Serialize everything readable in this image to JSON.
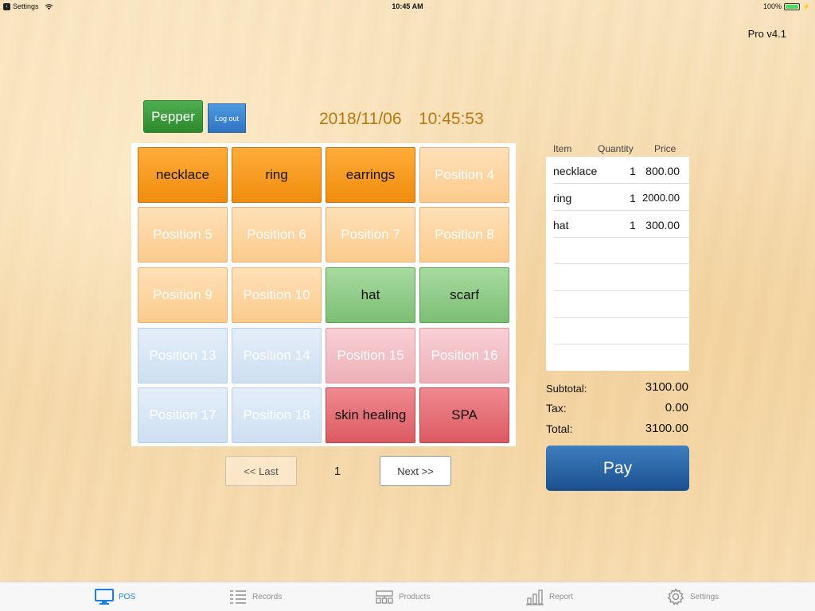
{
  "status_bar": {
    "back_label": "Settings",
    "time": "10:45 AM",
    "battery": "100%"
  },
  "app_version": "Pro v4.1",
  "header": {
    "user_name": "Pepper",
    "logout_label": "Log out",
    "date": "2018/11/06",
    "time": "10:45:53"
  },
  "tiles": [
    {
      "label": "necklace",
      "style": "orange-on"
    },
    {
      "label": "ring",
      "style": "orange-on"
    },
    {
      "label": "earrings",
      "style": "orange-on"
    },
    {
      "label": "Position 4",
      "style": "orange-off"
    },
    {
      "label": "Position 5",
      "style": "orange-off"
    },
    {
      "label": "Position 6",
      "style": "orange-off"
    },
    {
      "label": "Position 7",
      "style": "orange-off"
    },
    {
      "label": "Position 8",
      "style": "orange-off"
    },
    {
      "label": "Position 9",
      "style": "orange-off"
    },
    {
      "label": "Position 10",
      "style": "orange-off"
    },
    {
      "label": "hat",
      "style": "green-on"
    },
    {
      "label": "scarf",
      "style": "green-on"
    },
    {
      "label": "Position 13",
      "style": "blue-off"
    },
    {
      "label": "Position 14",
      "style": "blue-off"
    },
    {
      "label": "Position 15",
      "style": "pink-off"
    },
    {
      "label": "Position 16",
      "style": "pink-off"
    },
    {
      "label": "Position 17",
      "style": "blue-off"
    },
    {
      "label": "Position 18",
      "style": "blue-off"
    },
    {
      "label": "skin healing",
      "style": "red-on"
    },
    {
      "label": "SPA",
      "style": "red-on"
    }
  ],
  "pagination": {
    "prev_label": "<< Last",
    "page": "1",
    "next_label": "Next  >>"
  },
  "order": {
    "headers": {
      "item": "Item",
      "quantity": "Quantity",
      "price": "Price"
    },
    "rows": [
      {
        "name": "necklace",
        "qty": "1",
        "price": "800.00"
      },
      {
        "name": "ring",
        "qty": "1",
        "price": "2000.00"
      },
      {
        "name": "hat",
        "qty": "1",
        "price": "300.00"
      }
    ],
    "subtotal_label": "Subtotal:",
    "subtotal": "3100.00",
    "tax_label": "Tax:",
    "tax": "0.00",
    "total_label": "Total:",
    "total": "3100.00",
    "pay_label": "Pay"
  },
  "tabs": [
    {
      "label": "POS",
      "icon": "monitor-icon",
      "active": true
    },
    {
      "label": "Records",
      "icon": "list-icon",
      "active": false
    },
    {
      "label": "Products",
      "icon": "products-icon",
      "active": false
    },
    {
      "label": "Report",
      "icon": "bar-chart-icon",
      "active": false
    },
    {
      "label": "Settings",
      "icon": "gear-icon",
      "active": false
    }
  ],
  "colors": {
    "accent": "#1a7fe6",
    "date_text": "#b8780e",
    "pay_button": "#1a4f8e",
    "user_button": "#2c8a2c"
  }
}
